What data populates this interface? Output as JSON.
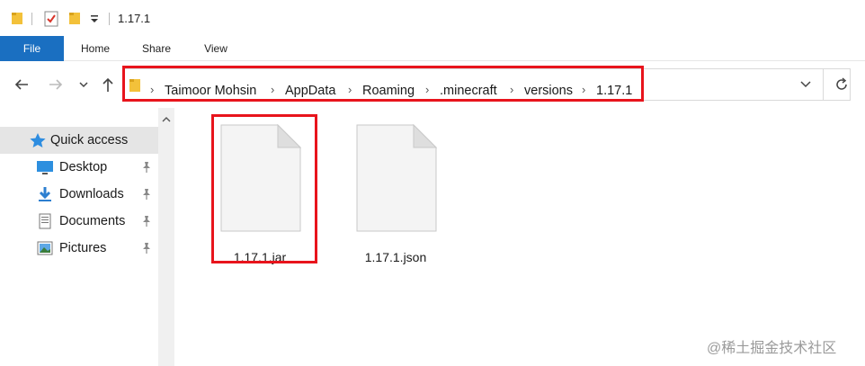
{
  "window": {
    "title": "1.17.1"
  },
  "ribbon": {
    "tabs": [
      "File",
      "Home",
      "Share",
      "View"
    ]
  },
  "address": {
    "crumbs": [
      "Taimoor Mohsin",
      "AppData",
      "Roaming",
      ".minecraft",
      "versions",
      "1.17.1"
    ]
  },
  "nav": {
    "items": [
      {
        "label": "Quick access",
        "icon": "star-icon"
      },
      {
        "label": "Desktop",
        "icon": "desktop-icon"
      },
      {
        "label": "Downloads",
        "icon": "download-icon"
      },
      {
        "label": "Documents",
        "icon": "documents-icon"
      },
      {
        "label": "Pictures",
        "icon": "pictures-icon"
      }
    ]
  },
  "files": [
    {
      "name": "1.17.1.jar"
    },
    {
      "name": "1.17.1.json"
    }
  ],
  "watermark": "@稀土掘金技术社区",
  "colors": {
    "accent": "#1a6fc1",
    "highlight": "#e8141c",
    "folder": "#f3c13a",
    "selected": "#e5e5e5"
  }
}
